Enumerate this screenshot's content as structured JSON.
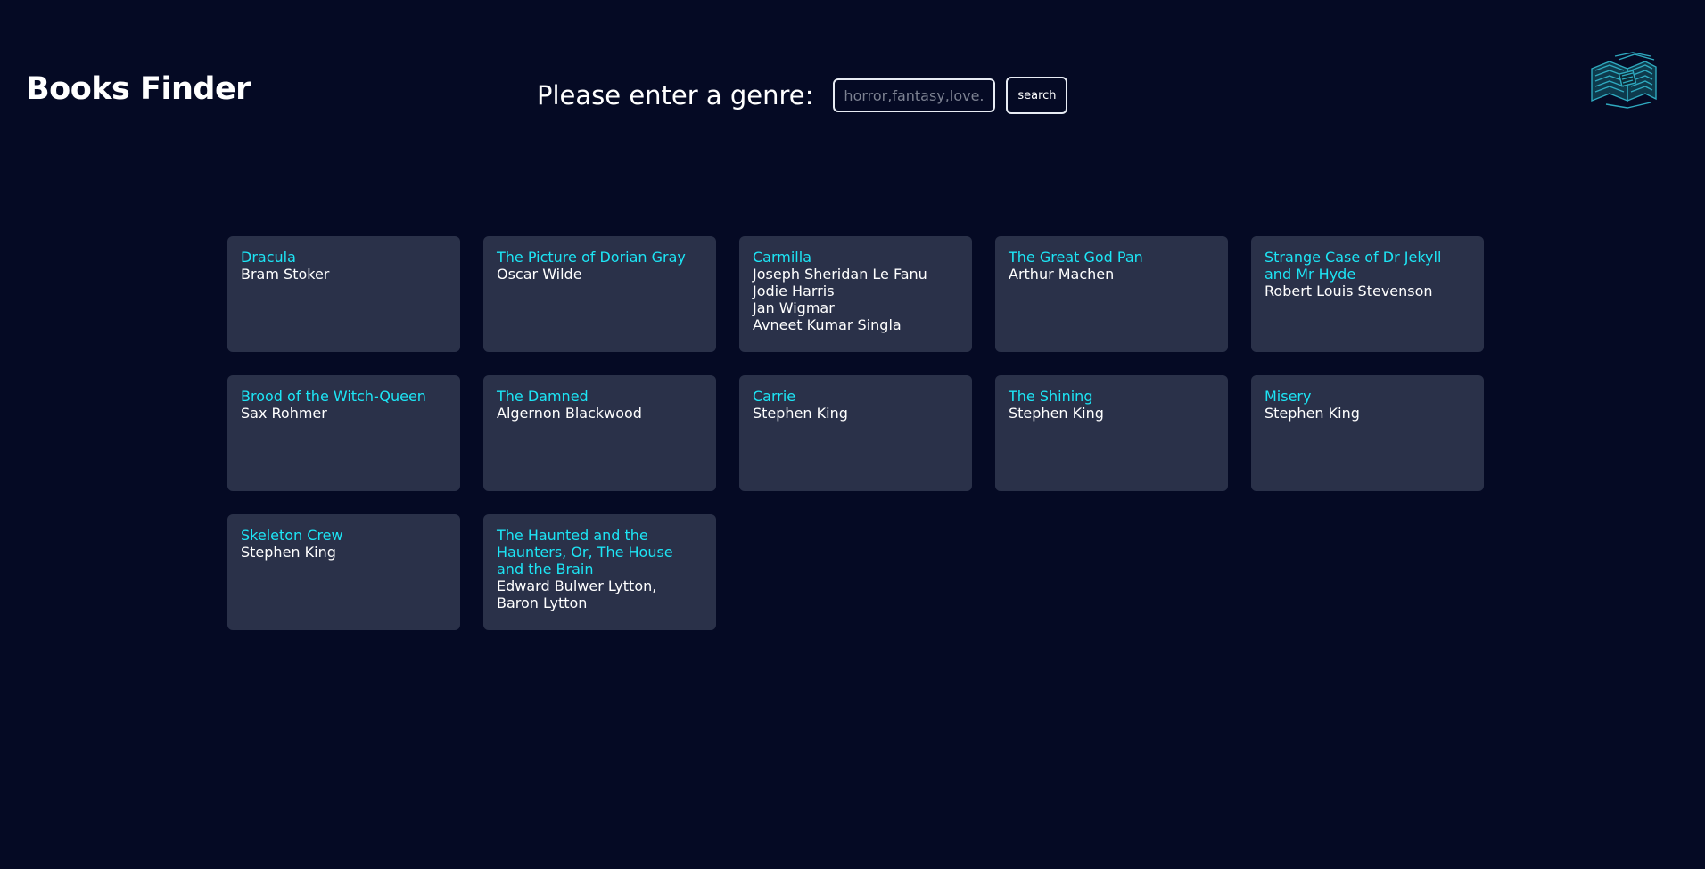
{
  "header": {
    "title": "Books Finder",
    "search_label": "Please enter a genre:",
    "search_placeholder": "horror,fantasy,love...",
    "search_value": "",
    "search_button": "search",
    "logo_icon": "open-book-icon"
  },
  "colors": {
    "background": "#050a24",
    "card": "#2a3149",
    "title_accent": "#1de5f5",
    "text": "#ffffff"
  },
  "books": [
    {
      "title": "Dracula",
      "authors": [
        "Bram Stoker"
      ]
    },
    {
      "title": "The Picture of Dorian Gray",
      "authors": [
        "Oscar Wilde"
      ]
    },
    {
      "title": "Carmilla",
      "authors": [
        "Joseph Sheridan Le Fanu",
        "Jodie Harris",
        "Jan Wigmar",
        "Avneet Kumar Singla"
      ]
    },
    {
      "title": "The Great God Pan",
      "authors": [
        "Arthur Machen"
      ]
    },
    {
      "title": "Strange Case of Dr Jekyll and Mr Hyde",
      "authors": [
        "Robert Louis Stevenson"
      ]
    },
    {
      "title": "Brood of the Witch-Queen",
      "authors": [
        "Sax Rohmer"
      ]
    },
    {
      "title": "The Damned",
      "authors": [
        "Algernon Blackwood"
      ]
    },
    {
      "title": "Carrie",
      "authors": [
        "Stephen King"
      ]
    },
    {
      "title": "The Shining",
      "authors": [
        "Stephen King"
      ]
    },
    {
      "title": "Misery",
      "authors": [
        "Stephen King"
      ]
    },
    {
      "title": "Skeleton Crew",
      "authors": [
        "Stephen King"
      ]
    },
    {
      "title": "The Haunted and the Haunters, Or, The House and the Brain",
      "authors": [
        "Edward Bulwer Lytton, Baron Lytton"
      ]
    }
  ]
}
